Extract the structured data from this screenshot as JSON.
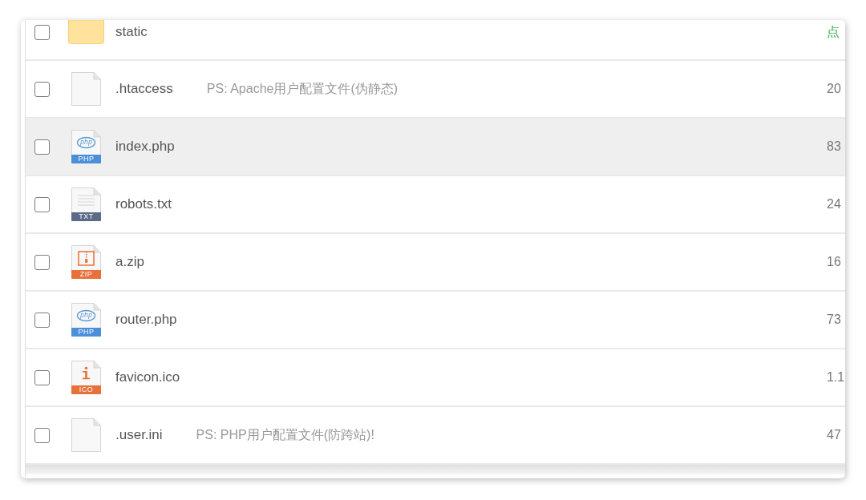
{
  "file_list": {
    "rows": [
      {
        "checked": false,
        "hovered": false,
        "icon": {
          "kind": "folder"
        },
        "name": "static",
        "column_3": {
          "kind": "link",
          "text": "点"
        }
      },
      {
        "checked": false,
        "hovered": false,
        "icon": {
          "kind": "blank"
        },
        "name": ".htaccess",
        "note": "PS: Apache用户配置文件(伪静态)",
        "column_3": {
          "kind": "value",
          "text": "20"
        }
      },
      {
        "checked": false,
        "hovered": true,
        "icon": {
          "kind": "php",
          "logo": "php",
          "label": "PHP"
        },
        "name": "index.php",
        "column_3": {
          "kind": "value",
          "text": "83"
        }
      },
      {
        "checked": false,
        "hovered": false,
        "icon": {
          "kind": "txt",
          "label": "TXT"
        },
        "name": "robots.txt",
        "column_3": {
          "kind": "value",
          "text": "24"
        }
      },
      {
        "checked": false,
        "hovered": false,
        "icon": {
          "kind": "zip",
          "label": "ZIP"
        },
        "name": "a.zip",
        "column_3": {
          "kind": "value",
          "text": "16"
        }
      },
      {
        "checked": false,
        "hovered": false,
        "icon": {
          "kind": "php",
          "logo": "php",
          "label": "PHP"
        },
        "name": "router.php",
        "column_3": {
          "kind": "value",
          "text": "73"
        }
      },
      {
        "checked": false,
        "hovered": false,
        "icon": {
          "kind": "ico",
          "label": "ICO"
        },
        "name": "favicon.ico",
        "column_3": {
          "kind": "value",
          "text": "1.1"
        }
      },
      {
        "checked": false,
        "hovered": false,
        "icon": {
          "kind": "blank"
        },
        "name": ".user.ini",
        "note": "PS: PHP用户配置文件(防跨站)!",
        "column_3": {
          "kind": "value",
          "text": "47"
        }
      }
    ]
  }
}
